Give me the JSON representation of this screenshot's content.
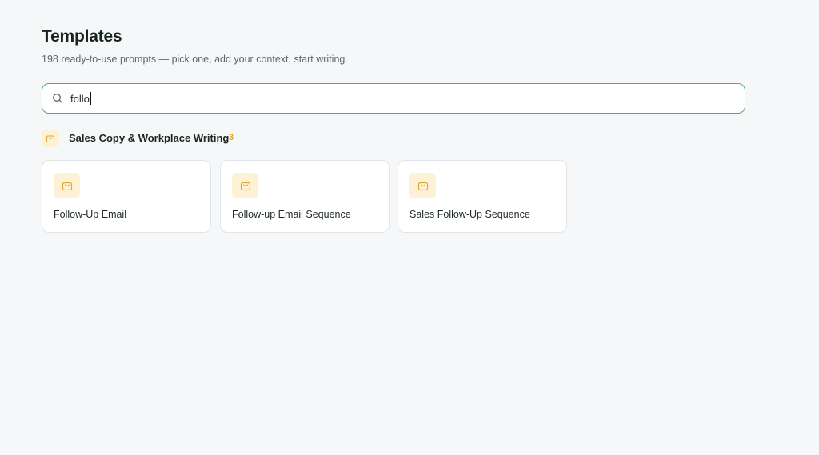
{
  "header": {
    "title": "Templates",
    "subtitle": "198 ready-to-use prompts — pick one, add your context, start writing."
  },
  "search": {
    "value": "follo",
    "icon": "search-icon"
  },
  "category": {
    "label": "Sales Copy & Workplace Writing",
    "count": "3",
    "icon": "shopping-bag-icon",
    "accent_color": "#e0a92a"
  },
  "cards": [
    {
      "label": "Follow-Up Email",
      "icon": "shopping-bag-icon"
    },
    {
      "label": "Follow-up Email Sequence",
      "icon": "shopping-bag-icon"
    },
    {
      "label": "Sales Follow-Up Sequence",
      "icon": "shopping-bag-icon"
    }
  ],
  "colors": {
    "search_border": "#4caf6e",
    "icon_bg": "#fdf2d6",
    "background": "#f6f7f9"
  }
}
